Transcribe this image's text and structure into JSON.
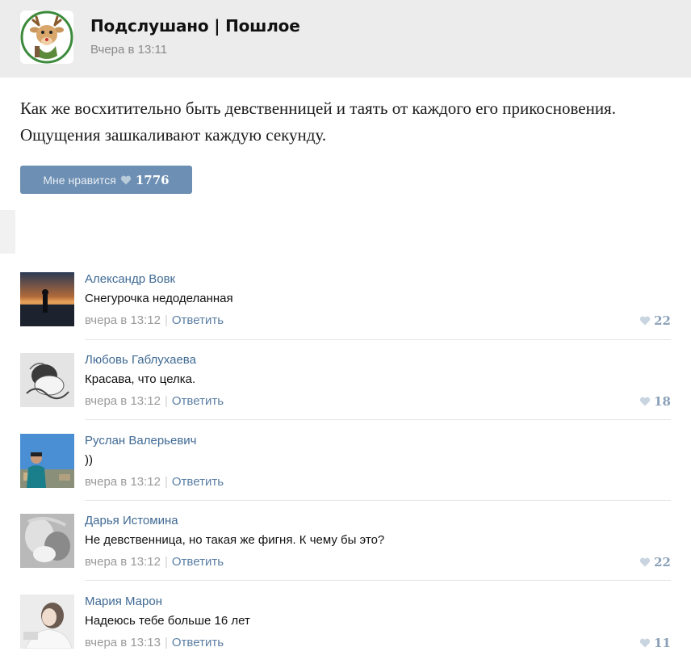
{
  "post": {
    "group_name": "Подслушано | Пошлое",
    "time": "Вчера в 13:11",
    "text": "Как же восхитительно быть девственницей и таять от каждого его прикосновения. Ощущения зашкаливают каждую секунду.",
    "like_label": "Мне нравится",
    "like_count": "1776"
  },
  "comments": [
    {
      "name": "Александр Вовк",
      "text": "Снегурочка недоделанная",
      "time": "вчера в 13:12",
      "reply": "Ответить",
      "likes": "22"
    },
    {
      "name": "Любовь Габлухаева",
      "text": "Красава, что целка.",
      "time": "вчера в 13:12",
      "reply": "Ответить",
      "likes": "18"
    },
    {
      "name": "Руслан Валерьевич",
      "text": "))",
      "time": "вчера в 13:12",
      "reply": "Ответить",
      "likes": ""
    },
    {
      "name": "Дарья Истомина",
      "text": "Не девственница, но такая же фигня. К чему бы это?",
      "time": "вчера в 13:12",
      "reply": "Ответить",
      "likes": "22"
    },
    {
      "name": "Мария Марон",
      "text": "Надеюсь тебе больше 16 лет",
      "time": "вчера в 13:13",
      "reply": "Ответить",
      "likes": "11"
    }
  ],
  "colors": {
    "link": "#3f6a94",
    "like_button": "#6d8fb3",
    "header_bg": "#ececec"
  },
  "icons": {
    "like": "heart-icon",
    "group_avatar": "deer-logo"
  }
}
